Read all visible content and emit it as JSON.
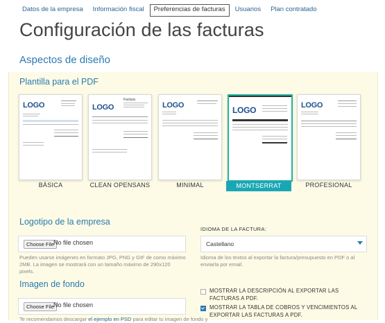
{
  "tabs": [
    {
      "label": "Datos de la empresa"
    },
    {
      "label": "Información fiscal"
    },
    {
      "label": "Preferencias de facturas"
    },
    {
      "label": "Usuarios"
    },
    {
      "label": "Plan contratado"
    }
  ],
  "page_title": "Configuración de las facturas",
  "design_section": "Aspectos de diseño",
  "pdf_template": {
    "heading": "Plantilla para el PDF",
    "templates": [
      {
        "label": "BÁSICA",
        "logo": "LOGO"
      },
      {
        "label": "CLEAN OPENSANS",
        "logo": "LOGO",
        "doc_title": "Factura"
      },
      {
        "label": "MINIMAL",
        "logo": "LOGO"
      },
      {
        "label": "MONTSERRAT",
        "logo": "LOGO"
      },
      {
        "label": "PROFESIONAL",
        "logo": "LOGO"
      }
    ],
    "selected": "MONTSERRAT"
  },
  "logo_section": {
    "heading": "Logotipo de la empresa",
    "button": "Choose File",
    "value": "No file chosen",
    "help": "Pueden usarse imágenes en formato JPG, PNG y GIF de como máximo 2MB. La imagen se mostrará con un tamaño máximo de 290x120 pixels."
  },
  "background_section": {
    "heading": "Imagen de fondo",
    "button": "Choose File",
    "value": "No file chosen",
    "help_start": "Te recomendamos descargar",
    "help_link": "el ejemplo en PSD",
    "help_end": "para editar tu imagen de fondo y"
  },
  "invoice_language": {
    "label": "IDIOMA DE LA FACTURA:",
    "value": "Castellano",
    "help": "Idioma de los textos al exportar la factura/presupuesto en PDF o al enviarla por email."
  },
  "options": [
    {
      "label": "MOSTRAR LA DESCRIPCIÓN AL EXPORTAR LAS FACTURAS A PDF.",
      "checked": false
    },
    {
      "label": "MOSTRAR LA TABLA DE COBROS Y VENCIMIENTOS AL EXPORTAR LAS FACTURAS A PDF.",
      "checked": true
    }
  ],
  "colors": {
    "accent": "#2a7ab0",
    "selected": "#1aa7b5",
    "panel": "#fdfbe6"
  }
}
